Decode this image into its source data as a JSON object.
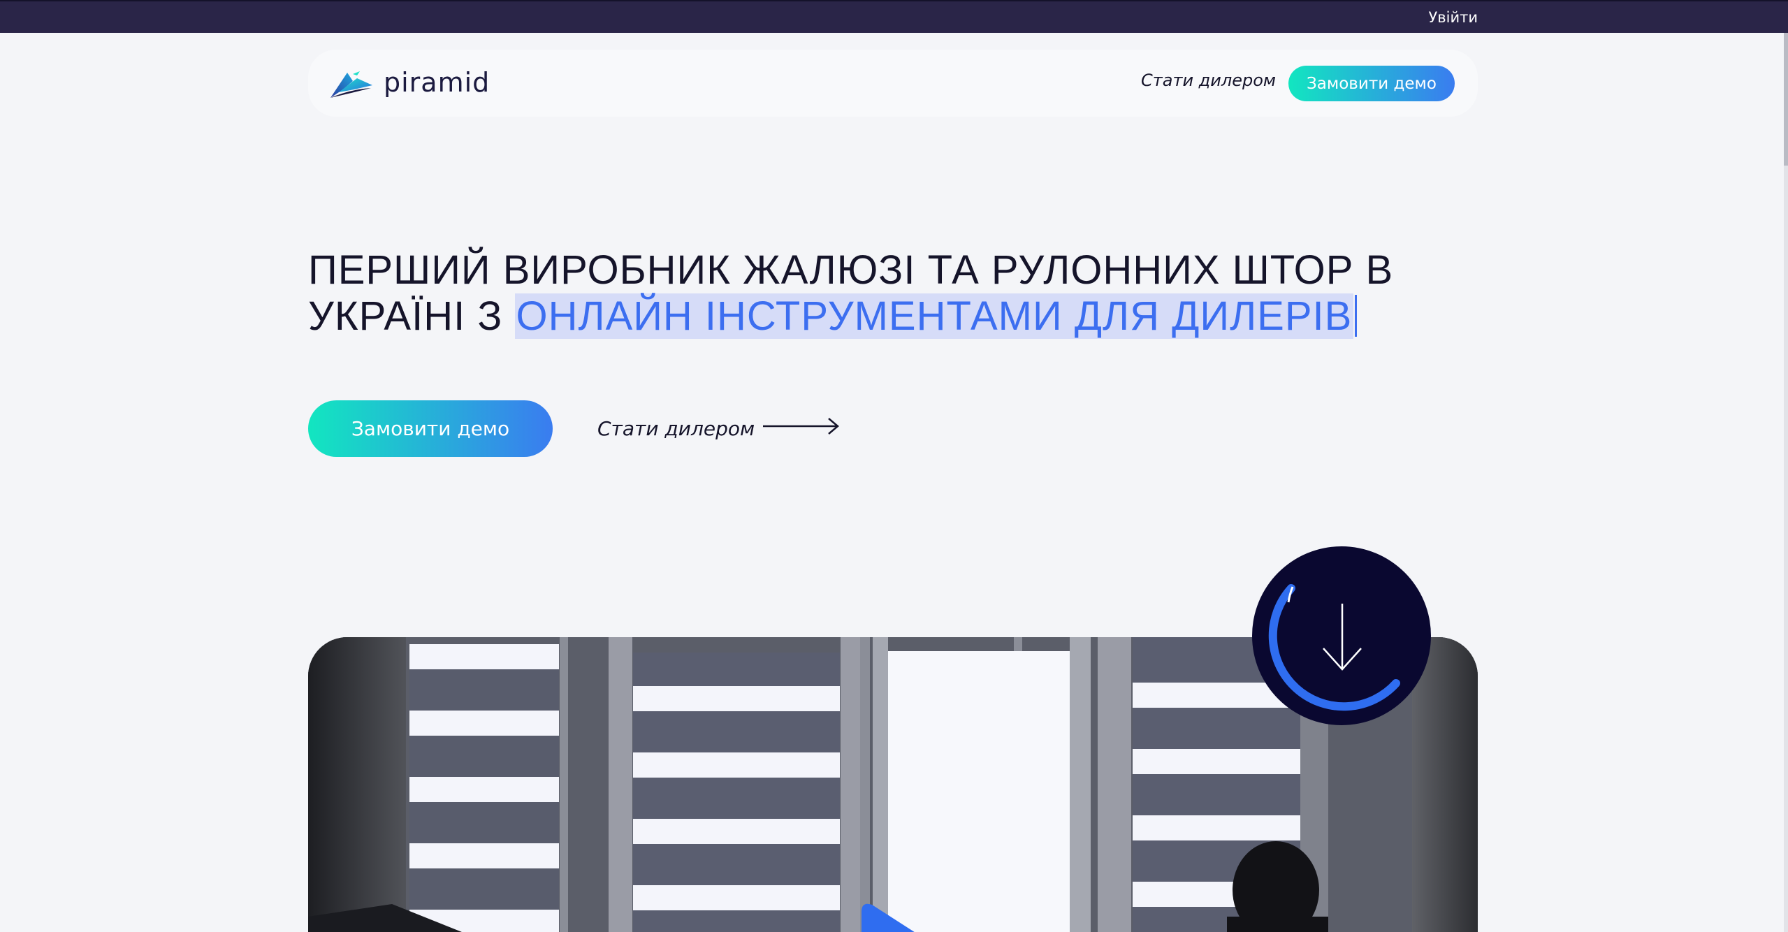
{
  "topbar": {
    "login_label": "Увійти"
  },
  "navbar": {
    "logo_text": "piramid",
    "dealer_link": "Стати дилером",
    "demo_button": "Замовити демо"
  },
  "hero": {
    "title_plain": "ПЕРШИЙ ВИРОБНИК ЖАЛЮЗІ ТА РУЛОННИХ ШТОР В УКРАЇНІ З ",
    "title_highlight": "ОНЛАЙН ІНСТРУМЕНТАМИ ДЛЯ ДИЛЕРІВ",
    "demo_button": "Замовити демо",
    "dealer_link": "Стати дилером"
  },
  "colors": {
    "topbar_bg": "#2a2548",
    "page_bg": "#f4f5f8",
    "accent_gradient_start": "#12e6c0",
    "accent_gradient_end": "#3a7cf0",
    "highlight_text": "#3c6ef0",
    "highlight_bg": "#d6dcf8",
    "badge_bg": "#0a0830"
  },
  "icons": {
    "logo": "piramid-logo-icon",
    "arrow": "arrow-right-icon",
    "scroll": "arrow-down-icon",
    "play": "play-icon"
  }
}
